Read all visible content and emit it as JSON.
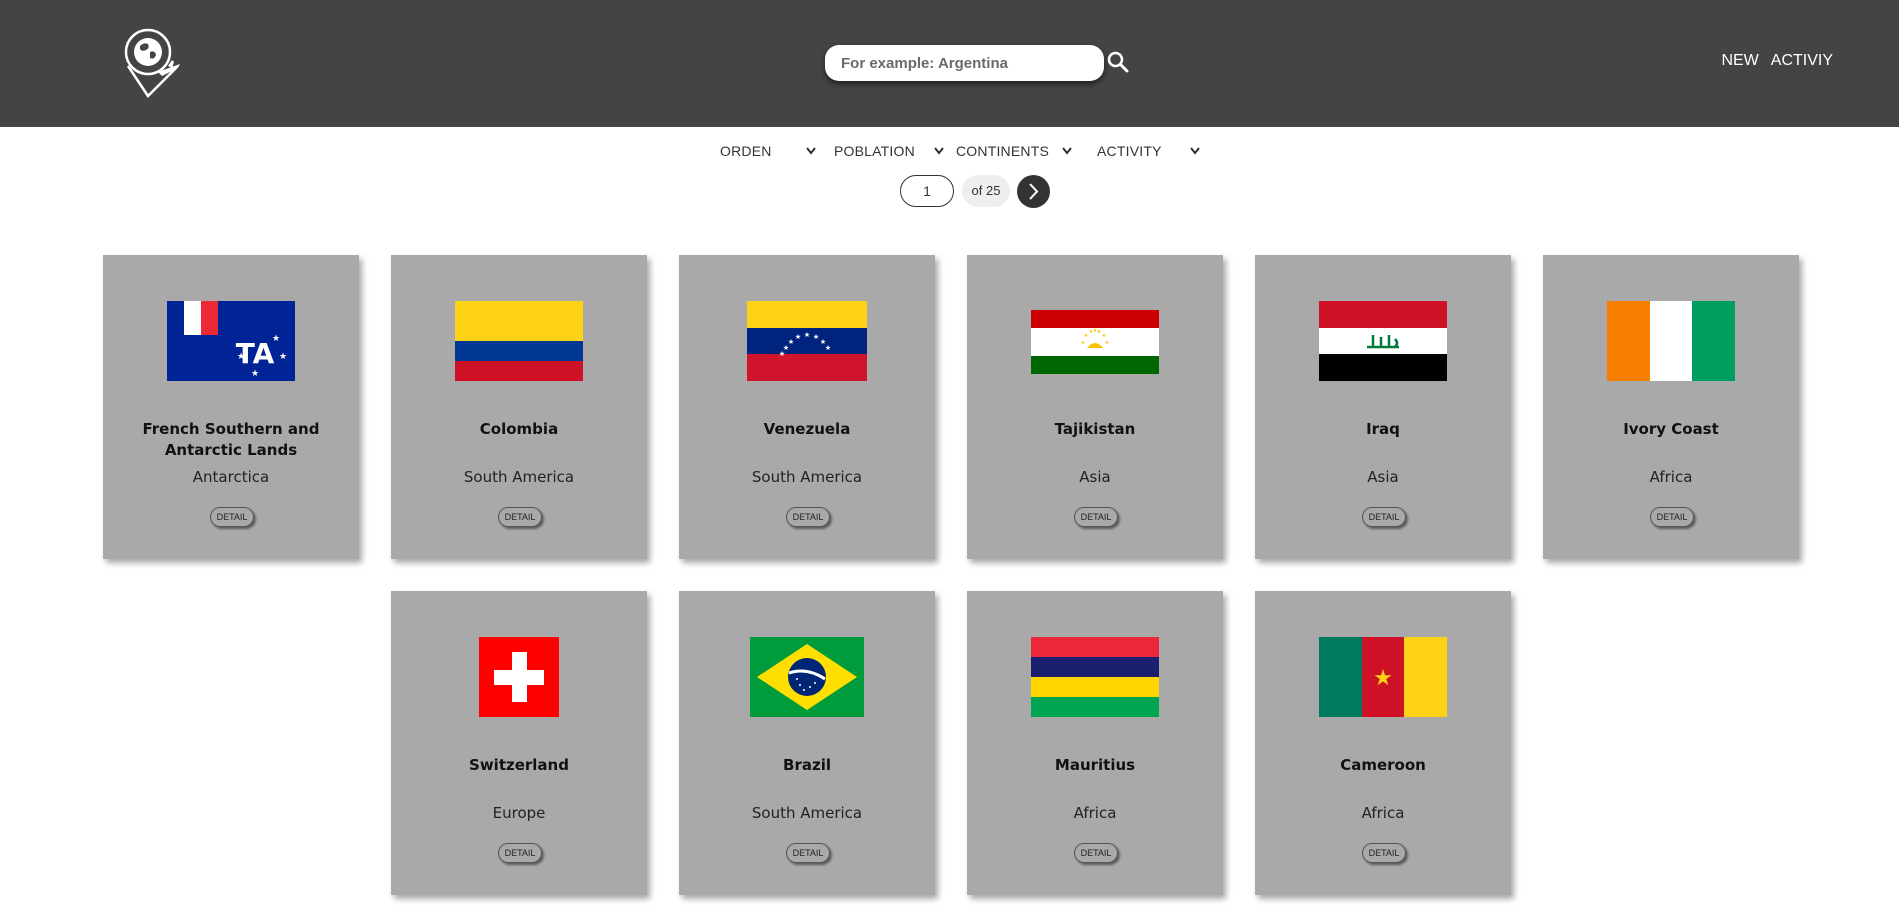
{
  "header": {
    "logo_icon": "globe-plane-pin-icon",
    "search": {
      "placeholder": "For example: Argentina",
      "value": ""
    },
    "search_icon": "search-icon",
    "nav": [
      "NEW",
      "ACTIVIY"
    ]
  },
  "filters": [
    {
      "label": "ORDEN"
    },
    {
      "label": "POBLATION"
    },
    {
      "label": "CONTINENTS"
    },
    {
      "label": "ACTIVITY"
    }
  ],
  "pagination": {
    "current": "1",
    "total_label": "of 25",
    "next_icon": "chevron-right-icon"
  },
  "cards": [
    {
      "name": "French Southern and Antarctic Lands",
      "continent": "Antarctica",
      "flag": "TF",
      "button": "DETAIL"
    },
    {
      "name": "Colombia",
      "continent": "South America",
      "flag": "CO",
      "button": "DETAIL"
    },
    {
      "name": "Venezuela",
      "continent": "South America",
      "flag": "VE",
      "button": "DETAIL"
    },
    {
      "name": "Tajikistan",
      "continent": "Asia",
      "flag": "TJ",
      "button": "DETAIL"
    },
    {
      "name": "Iraq",
      "continent": "Asia",
      "flag": "IQ",
      "button": "DETAIL"
    },
    {
      "name": "Ivory Coast",
      "continent": "Africa",
      "flag": "CI",
      "button": "DETAIL"
    },
    {
      "name": "Switzerland",
      "continent": "Europe",
      "flag": "CH",
      "button": "DETAIL"
    },
    {
      "name": "Brazil",
      "continent": "South America",
      "flag": "BR",
      "button": "DETAIL"
    },
    {
      "name": "Mauritius",
      "continent": "Africa",
      "flag": "MU",
      "button": "DETAIL"
    },
    {
      "name": "Cameroon",
      "continent": "Africa",
      "flag": "CM",
      "button": "DETAIL"
    }
  ]
}
